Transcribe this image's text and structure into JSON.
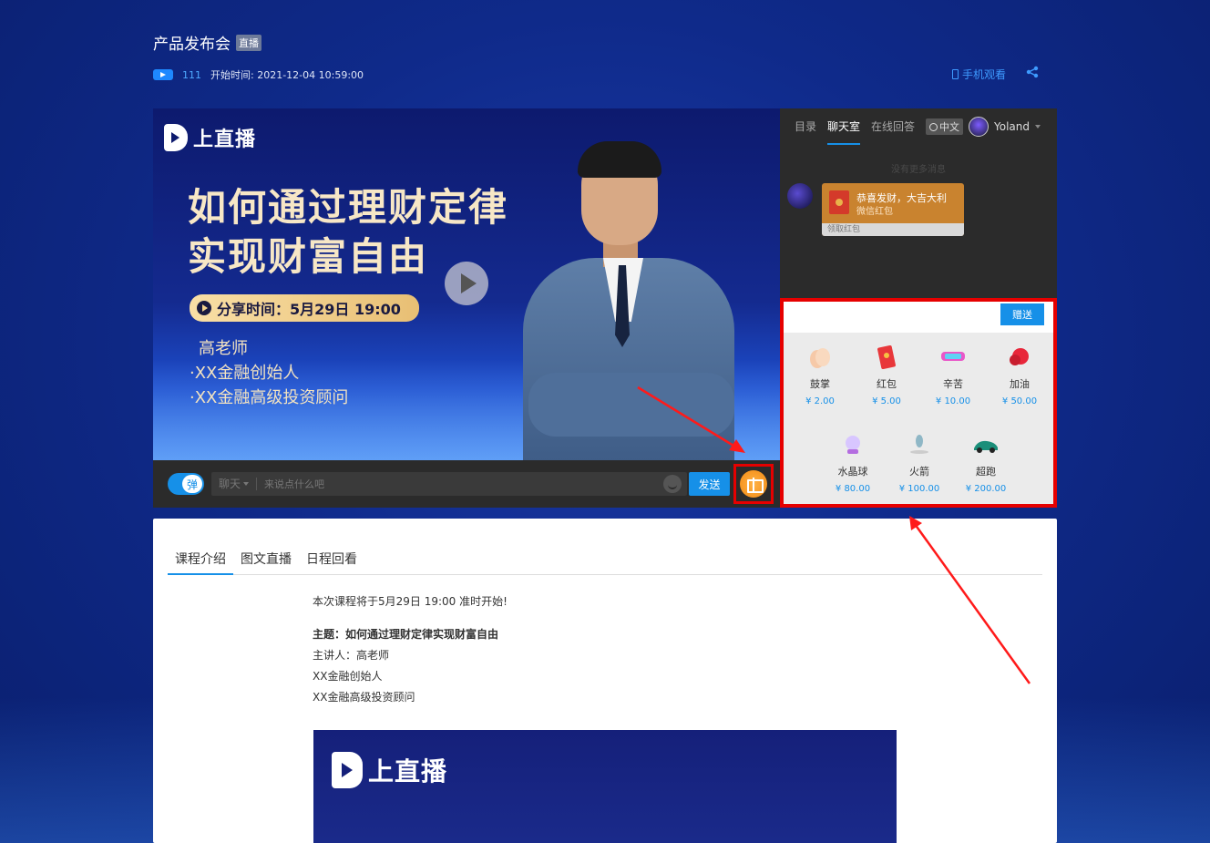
{
  "header": {
    "title": "产品发布会",
    "live_badge": "直播",
    "viewer_count": "111",
    "start_time": "开始时间: 2021-12-04 10:59:00",
    "mobile_watch": "手机观看"
  },
  "video": {
    "brand": "上直播",
    "headline_line1": "如何通过理财定律",
    "headline_line2": "实现财富自由",
    "share_time": "分享时间：5月29日 19:00",
    "speaker_name": "高老师",
    "speaker_title1": "·XX金融创始人",
    "speaker_title2": "·XX金融高级投资顾问"
  },
  "chatbar": {
    "danmu_label": "弹",
    "mode": "聊天",
    "placeholder": "来说点什么吧",
    "send_label": "发送"
  },
  "side": {
    "tabs": [
      "目录",
      "聊天室",
      "在线回答"
    ],
    "language": "中文",
    "username": "Yoland",
    "no_more": "没有更多消息",
    "redpacket": {
      "title": "恭喜发财，大吉大利",
      "subtitle": "微信红包",
      "footer": "领取红包"
    }
  },
  "gift_panel": {
    "give_label": "赠送",
    "gifts": [
      {
        "name": "鼓掌",
        "price": "¥ 2.00",
        "icon": "clap-icon"
      },
      {
        "name": "红包",
        "price": "¥ 5.00",
        "icon": "red-envelope-icon"
      },
      {
        "name": "辛苦",
        "price": "¥ 10.00",
        "icon": "thanks-sign-icon"
      },
      {
        "name": "加油",
        "price": "¥ 50.00",
        "icon": "boxing-glove-icon"
      },
      {
        "name": "水晶球",
        "price": "¥ 80.00",
        "icon": "crystal-ball-icon"
      },
      {
        "name": "火箭",
        "price": "¥ 100.00",
        "icon": "rocket-icon"
      },
      {
        "name": "超跑",
        "price": "¥ 200.00",
        "icon": "sports-car-icon"
      }
    ]
  },
  "content": {
    "tabs": [
      "课程介绍",
      "图文直播",
      "日程回看"
    ],
    "intro_line": "本次课程将于5月29日 19:00 准时开始!",
    "topic": "主题：如何通过理财定律实现财富自由",
    "presenter": "主讲人：高老师",
    "title1": "XX金融创始人",
    "title2": "XX金融高级投资顾问",
    "banner_brand": "上直播"
  },
  "colors": {
    "accent": "#1690e8",
    "highlight_border": "#e60000",
    "gift_price": "#1690e8"
  }
}
